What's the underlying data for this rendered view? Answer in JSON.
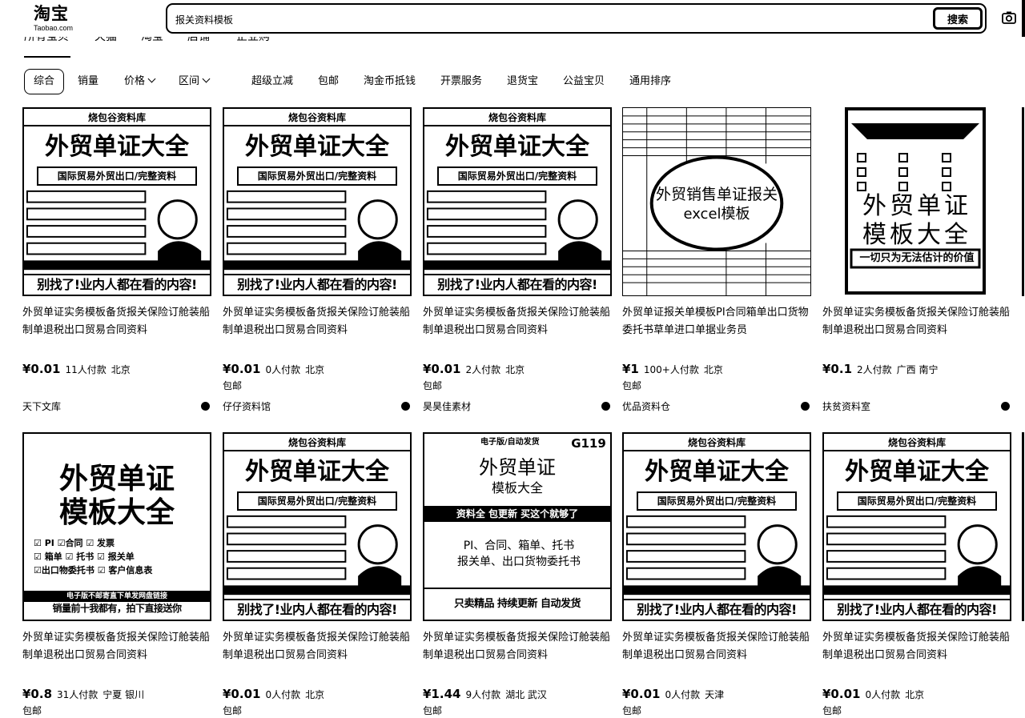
{
  "header": {
    "logo_text": "淘宝",
    "logo_sub": "Taobao.com",
    "search_value": "报关资料模板",
    "search_button": "搜索"
  },
  "category_tabs": [
    "所有宝贝",
    "天猫",
    "淘宝",
    "店铺",
    "企业购"
  ],
  "filters": {
    "sort_default": "综合",
    "sort_sales": "销量",
    "price": "价格",
    "region": "区间",
    "toggles": [
      "超级立减",
      "包邮",
      "淘金币抵钱",
      "开票服务",
      "退货宝",
      "公益宝贝",
      "通用排序"
    ]
  },
  "products": [
    {
      "title": "外贸单证实务模板备货报关保险订舱装船制单退税出口贸易合同资料",
      "price": "¥0.01",
      "sold": "11人付款",
      "location": "北京",
      "shipping": "",
      "shop": "天下文库",
      "thumb": {
        "brand": "烧包谷资料库",
        "headline": "外贸单证大全",
        "sub": "国际贸易外贸出口/完整资料",
        "bottom": "别找了!业内人都在看的内容!"
      }
    },
    {
      "title": "外贸单证实务模板备货报关保险订舱装船制单退税出口贸易合同资料",
      "price": "¥0.01",
      "sold": "0人付款",
      "location": "北京",
      "shipping": "包邮",
      "shop": "仔仔资料馆",
      "thumb": {
        "brand": "烧包谷资料库",
        "headline": "外贸单证大全",
        "sub": "国际贸易外贸出口/完整资料",
        "bottom": "别找了!业内人都在看的内容!"
      }
    },
    {
      "title": "外贸单证实务模板备货报关保险订舱装船制单退税出口贸易合同资料",
      "price": "¥0.01",
      "sold": "2人付款",
      "location": "北京",
      "shipping": "包邮",
      "shop": "昊昊佳素材",
      "thumb": {
        "brand": "烧包谷资料库",
        "headline": "外贸单证大全",
        "sub": "国际贸易外贸出口/完整资料",
        "bottom": "别找了!业内人都在看的内容!"
      }
    },
    {
      "title": "外贸单证报关单模板PI合同箱单出口货物委托书草单进口单据业务员",
      "price": "¥1",
      "sold": "100+人付款",
      "location": "北京",
      "shipping": "包邮",
      "shop": "优品资料仓",
      "thumb": {
        "headline": "外贸销售单证报关",
        "sub": "excel模板"
      }
    },
    {
      "title": "外贸单证实务模板备货报关保险订舱装船制单退税出口贸易合同资料",
      "price": "¥0.1",
      "sold": "2人付款",
      "location": "广西 南宁",
      "shipping": "",
      "shop": "扶贫资料室",
      "thumb": {
        "headline": "外贸单证",
        "headline2": "模板大全",
        "bottom": "一切只为无法估计的价值"
      }
    },
    {
      "title": "外贸单证实务模板备货报关保险订舱装船制单退税出口贸易合同资料",
      "price": "¥0.8",
      "sold": "31人付款",
      "location": "宁夏 银川",
      "shipping": "包邮",
      "shop": "",
      "thumb": {
        "headline": "外贸单证",
        "headline2": "模板大全",
        "lines": [
          "☑ PI  ☑合同  ☑ 发票",
          "☑ 箱单  ☑ 托书  ☑ 报关单",
          "☑出口物委托书 ☑ 客户信息表"
        ],
        "band": "电子版不邮寄直下单发网盘链接",
        "bottom": "销量前十我都有，拍下直接送你"
      }
    },
    {
      "title": "外贸单证实务模板备货报关保险订舱装船制单退税出口贸易合同资料",
      "price": "¥0.01",
      "sold": "0人付款",
      "location": "北京",
      "shipping": "包邮",
      "shop": "",
      "thumb": {
        "brand": "烧包谷资料库",
        "headline": "外贸单证大全",
        "sub": "国际贸易外贸出口/完整资料",
        "bottom": "别找了!业内人都在看的内容!"
      }
    },
    {
      "title": "外贸单证实务模板备货报关保险订舱装船制单退税出口贸易合同资料",
      "price": "¥1.44",
      "sold": "9人付款",
      "location": "湖北 武汉",
      "shipping": "包邮",
      "shop": "",
      "thumb": {
        "brand": "电子版/自动发货",
        "code": "G119",
        "headline": "外贸单证",
        "headline2": "模板大全",
        "band": "资料全 包更新  买这个就够了",
        "lines": [
          "PI、合同、箱单、托书",
          "报关单、出口货物委托书"
        ],
        "bottom": "只卖精品 持续更新  自动发货"
      }
    },
    {
      "title": "外贸单证实务模板备货报关保险订舱装船制单退税出口贸易合同资料",
      "price": "¥0.01",
      "sold": "0人付款",
      "location": "天津",
      "shipping": "包邮",
      "shop": "",
      "thumb": {
        "brand": "烧包谷资料库",
        "headline": "外贸单证大全",
        "sub": "国际贸易外贸出口/完整资料",
        "bottom": "别找了!业内人都在看的内容!"
      }
    },
    {
      "title": "外贸单证实务模板备货报关保险订舱装船制单退税出口贸易合同资料",
      "price": "¥0.01",
      "sold": "0人付款",
      "location": "北京",
      "shipping": "包邮",
      "shop": "",
      "thumb": {
        "brand": "烧包谷资料库",
        "headline": "外贸单证大全",
        "sub": "国际贸易外贸出口/完整资料",
        "bottom": "别找了!业内人都在看的内容!"
      }
    }
  ]
}
